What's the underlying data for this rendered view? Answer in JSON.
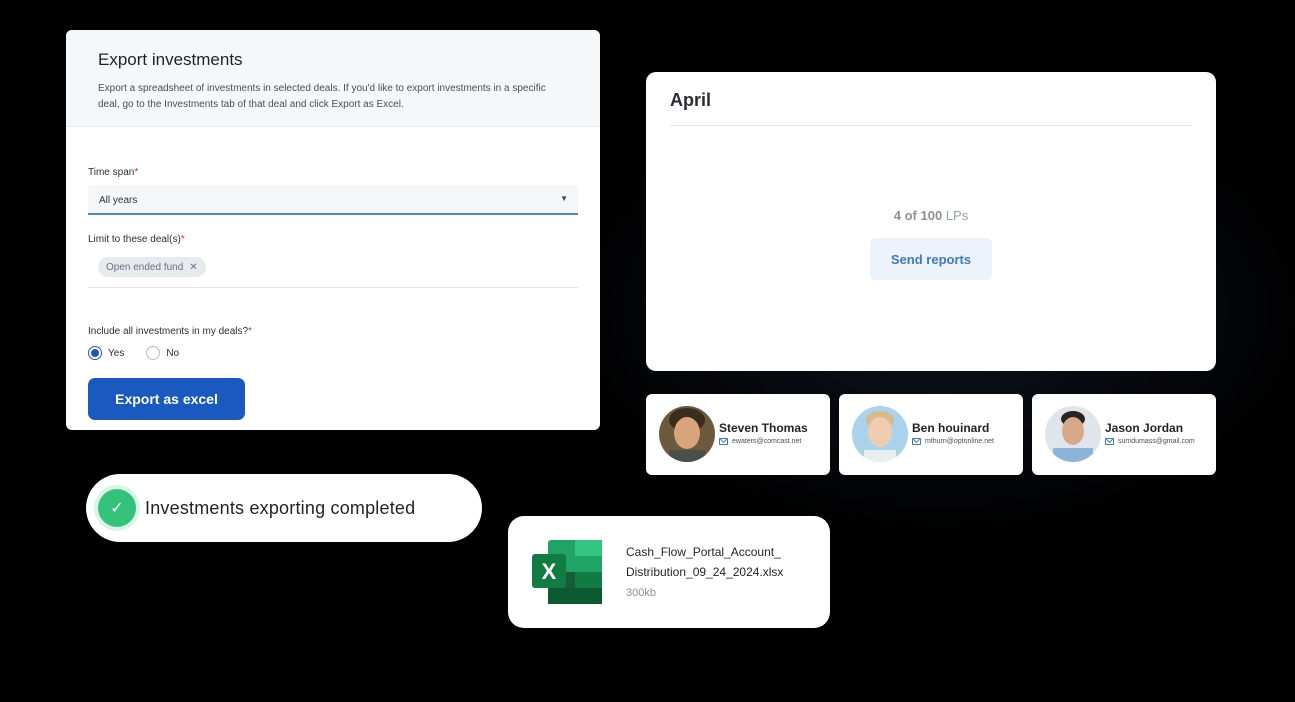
{
  "export": {
    "title": "Export investments",
    "description": "Export a spreadsheet of investments in selected deals. If you'd like to export investments in a specific deal, go to the Investments tab of that deal and click Export as Excel.",
    "time_span_label": "Time span",
    "time_span_value": "All years",
    "deals_label": "Limit to these deal(s)",
    "deal_chip": "Open ended fund",
    "include_label": "Include all investments in my deals?",
    "required_mark": "*",
    "radio_yes": "Yes",
    "radio_no": "No",
    "selected_option": "Yes",
    "button_label": "Export as excel",
    "accent_color": "#1a5ac0"
  },
  "report": {
    "month": "April",
    "count_bold": "4 of 100",
    "count_unit": "LPs",
    "button_label": "Send reports"
  },
  "people": [
    {
      "name": "Steven Thomas",
      "email": "ewaters@comcast.net"
    },
    {
      "name": "Ben houinard",
      "email": "mthurn@optonline.net"
    },
    {
      "name": "Jason Jordan",
      "email": "sumdumass@gmail.com"
    }
  ],
  "toast": {
    "message": "Investments exporting completed",
    "status_color": "#34c27a"
  },
  "file": {
    "name_line1": "Cash_Flow_Portal_Account_",
    "name_line2": "Distribution_09_24_2024.xlsx",
    "size": "300kb",
    "icon": "excel-icon"
  }
}
